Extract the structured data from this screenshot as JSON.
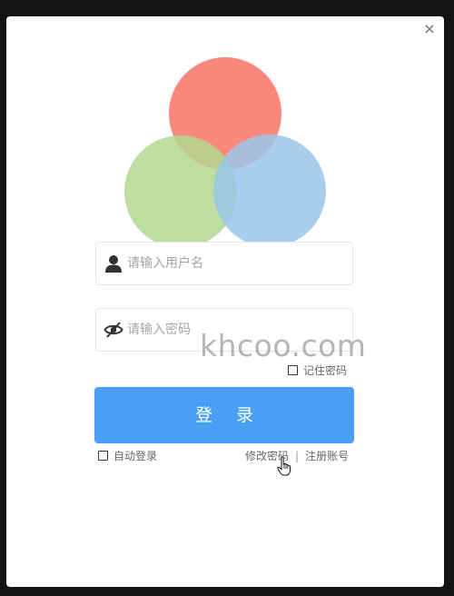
{
  "dialog": {
    "close_glyph": "×"
  },
  "logo": {
    "circle_colors": [
      "#fa7b6e",
      "#b1d88f",
      "#9ac5ea"
    ]
  },
  "form": {
    "username_placeholder": "请输入用户名",
    "password_placeholder": "请输入密码",
    "username_value": "",
    "password_value": "",
    "remember_label": "记住密码",
    "remember_checked": false,
    "login_label": "登 录",
    "auto_login_label": "自动登录",
    "auto_login_checked": false,
    "change_password_label": "修改密码",
    "separator": "|",
    "register_label": "注册账号"
  },
  "watermark": "khcoo.com",
  "colors": {
    "accent": "#4a9ff5",
    "backdrop": "#141414"
  },
  "icons": {
    "username": "user-icon",
    "password": "eye-slash-icon",
    "close": "close-icon",
    "pointer": "hand-cursor-icon"
  }
}
